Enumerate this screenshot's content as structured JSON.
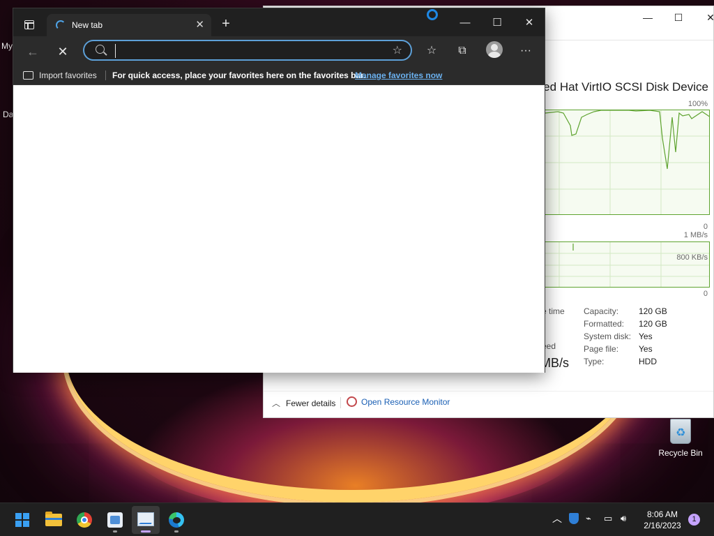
{
  "desktop": {
    "left_icon_1": "My",
    "left_icon_2": "Da",
    "recycle_bin_label": "Recycle Bin"
  },
  "task_manager": {
    "disk_title": "Red Hat VirtIO SCSI Disk Device",
    "graph1_top_label": "100%",
    "graph1_bottom_label": "0",
    "graph2_top_label": "1 MB/s",
    "graph2_mid_label": "800 KB/s",
    "graph2_bottom_label": "0",
    "partial_label_1": "e time",
    "partial_label_2": "eed",
    "partial_value": "MB/s",
    "properties": [
      {
        "label": "Capacity:",
        "value": "120 GB"
      },
      {
        "label": "Formatted:",
        "value": "120 GB"
      },
      {
        "label": "System disk:",
        "value": "Yes"
      },
      {
        "label": "Page file:",
        "value": "Yes"
      },
      {
        "label": "Type:",
        "value": "HDD"
      }
    ],
    "fewer_details": "Fewer details",
    "open_resource_monitor": "Open Resource Monitor",
    "colors": {
      "graph_line": "#5ea32f",
      "graph_fill": "#f6fbf1",
      "link": "#1a5fb4"
    }
  },
  "browser": {
    "tab_title": "New tab",
    "address_value": "",
    "address_placeholder": "",
    "favbar_import": "Import favorites",
    "favbar_hint": "For quick access, place your favorites here on the favorites bar.",
    "favbar_link": "Manage favorites now",
    "colors": {
      "chrome_dark": "#202020",
      "toolbar": "#2b2b2b",
      "focus_ring": "#5da0d8",
      "link": "#6bb1ef"
    }
  },
  "taskbar": {
    "apps": [
      "start-icon",
      "file-explorer-icon",
      "chrome-icon",
      "resource-monitor-icon",
      "task-manager-icon",
      "edge-icon"
    ],
    "time": "8:06 AM",
    "date": "2/16/2023",
    "notification_count": "1"
  }
}
